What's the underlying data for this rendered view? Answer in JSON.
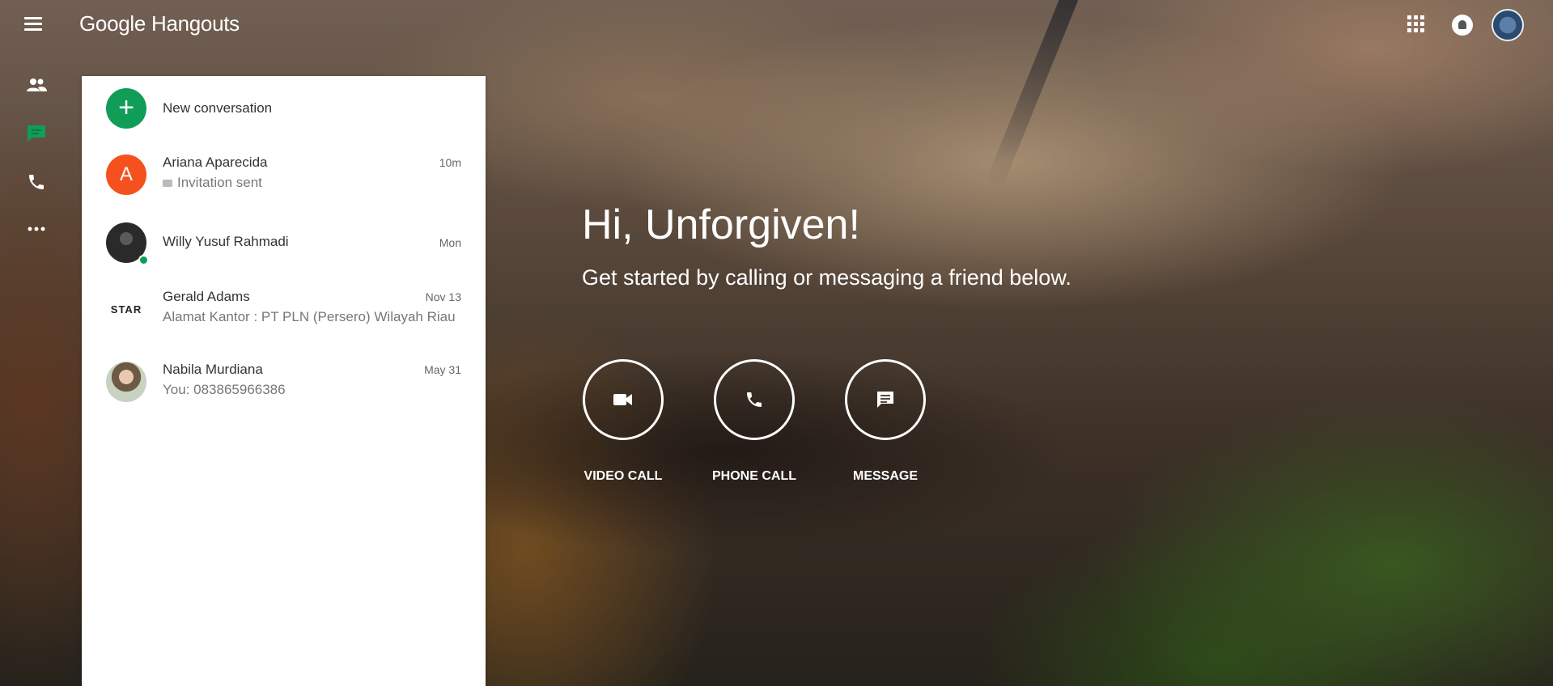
{
  "header": {
    "menu_icon": "menu-icon",
    "app_title": "Google Hangouts",
    "apps_icon": "apps-grid-icon",
    "notifications_icon": "notifications-icon",
    "account_icon": "account-avatar"
  },
  "rail": {
    "items": [
      {
        "name": "contacts",
        "icon": "people-icon"
      },
      {
        "name": "conversations",
        "icon": "chat-icon",
        "active": true
      },
      {
        "name": "phone-calls",
        "icon": "phone-icon"
      },
      {
        "name": "more",
        "icon": "more-horiz-icon"
      }
    ]
  },
  "panel": {
    "new_conversation": "New conversation",
    "conversations": [
      {
        "avatar_letter": "A",
        "name": "Ariana Aparecida",
        "snippet": "Invitation sent",
        "time": "10m"
      },
      {
        "name": "Willy Yusuf Rahmadi",
        "snippet": "",
        "time": "Mon",
        "online": true
      },
      {
        "avatar_text": "STAR",
        "name": "Gerald Adams",
        "snippet": "Alamat Kantor : PT PLN (Persero) Wilayah Riau",
        "time": "Nov 13"
      },
      {
        "name": "Nabila Murdiana",
        "snippet": "You: 083865966386",
        "time": "May 31"
      }
    ]
  },
  "welcome": {
    "greeting": "Hi, Unforgiven!",
    "subtitle": "Get started by calling or messaging a friend below.",
    "actions": [
      {
        "label": "VIDEO CALL",
        "icon": "videocam-icon"
      },
      {
        "label": "PHONE CALL",
        "icon": "phone-icon"
      },
      {
        "label": "MESSAGE",
        "icon": "message-icon"
      }
    ]
  },
  "colors": {
    "accent_green": "#0f9d58",
    "avatar_orange": "#f4511e",
    "panel_bg": "#ffffff"
  }
}
